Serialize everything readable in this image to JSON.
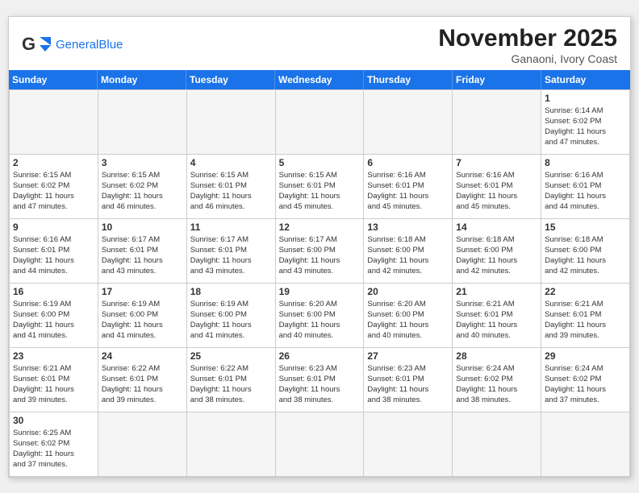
{
  "header": {
    "logo_general": "General",
    "logo_blue": "Blue",
    "month_title": "November 2025",
    "location": "Ganaoni, Ivory Coast"
  },
  "day_headers": [
    "Sunday",
    "Monday",
    "Tuesday",
    "Wednesday",
    "Thursday",
    "Friday",
    "Saturday"
  ],
  "cells": [
    {
      "day": "",
      "empty": true
    },
    {
      "day": "",
      "empty": true
    },
    {
      "day": "",
      "empty": true
    },
    {
      "day": "",
      "empty": true
    },
    {
      "day": "",
      "empty": true
    },
    {
      "day": "",
      "empty": true
    },
    {
      "day": "1",
      "info": "Sunrise: 6:14 AM\nSunset: 6:02 PM\nDaylight: 11 hours\nand 47 minutes."
    },
    {
      "day": "2",
      "info": "Sunrise: 6:15 AM\nSunset: 6:02 PM\nDaylight: 11 hours\nand 47 minutes."
    },
    {
      "day": "3",
      "info": "Sunrise: 6:15 AM\nSunset: 6:02 PM\nDaylight: 11 hours\nand 46 minutes."
    },
    {
      "day": "4",
      "info": "Sunrise: 6:15 AM\nSunset: 6:01 PM\nDaylight: 11 hours\nand 46 minutes."
    },
    {
      "day": "5",
      "info": "Sunrise: 6:15 AM\nSunset: 6:01 PM\nDaylight: 11 hours\nand 45 minutes."
    },
    {
      "day": "6",
      "info": "Sunrise: 6:16 AM\nSunset: 6:01 PM\nDaylight: 11 hours\nand 45 minutes."
    },
    {
      "day": "7",
      "info": "Sunrise: 6:16 AM\nSunset: 6:01 PM\nDaylight: 11 hours\nand 45 minutes."
    },
    {
      "day": "8",
      "info": "Sunrise: 6:16 AM\nSunset: 6:01 PM\nDaylight: 11 hours\nand 44 minutes."
    },
    {
      "day": "9",
      "info": "Sunrise: 6:16 AM\nSunset: 6:01 PM\nDaylight: 11 hours\nand 44 minutes."
    },
    {
      "day": "10",
      "info": "Sunrise: 6:17 AM\nSunset: 6:01 PM\nDaylight: 11 hours\nand 43 minutes."
    },
    {
      "day": "11",
      "info": "Sunrise: 6:17 AM\nSunset: 6:01 PM\nDaylight: 11 hours\nand 43 minutes."
    },
    {
      "day": "12",
      "info": "Sunrise: 6:17 AM\nSunset: 6:00 PM\nDaylight: 11 hours\nand 43 minutes."
    },
    {
      "day": "13",
      "info": "Sunrise: 6:18 AM\nSunset: 6:00 PM\nDaylight: 11 hours\nand 42 minutes."
    },
    {
      "day": "14",
      "info": "Sunrise: 6:18 AM\nSunset: 6:00 PM\nDaylight: 11 hours\nand 42 minutes."
    },
    {
      "day": "15",
      "info": "Sunrise: 6:18 AM\nSunset: 6:00 PM\nDaylight: 11 hours\nand 42 minutes."
    },
    {
      "day": "16",
      "info": "Sunrise: 6:19 AM\nSunset: 6:00 PM\nDaylight: 11 hours\nand 41 minutes."
    },
    {
      "day": "17",
      "info": "Sunrise: 6:19 AM\nSunset: 6:00 PM\nDaylight: 11 hours\nand 41 minutes."
    },
    {
      "day": "18",
      "info": "Sunrise: 6:19 AM\nSunset: 6:00 PM\nDaylight: 11 hours\nand 41 minutes."
    },
    {
      "day": "19",
      "info": "Sunrise: 6:20 AM\nSunset: 6:00 PM\nDaylight: 11 hours\nand 40 minutes."
    },
    {
      "day": "20",
      "info": "Sunrise: 6:20 AM\nSunset: 6:00 PM\nDaylight: 11 hours\nand 40 minutes."
    },
    {
      "day": "21",
      "info": "Sunrise: 6:21 AM\nSunset: 6:01 PM\nDaylight: 11 hours\nand 40 minutes."
    },
    {
      "day": "22",
      "info": "Sunrise: 6:21 AM\nSunset: 6:01 PM\nDaylight: 11 hours\nand 39 minutes."
    },
    {
      "day": "23",
      "info": "Sunrise: 6:21 AM\nSunset: 6:01 PM\nDaylight: 11 hours\nand 39 minutes."
    },
    {
      "day": "24",
      "info": "Sunrise: 6:22 AM\nSunset: 6:01 PM\nDaylight: 11 hours\nand 39 minutes."
    },
    {
      "day": "25",
      "info": "Sunrise: 6:22 AM\nSunset: 6:01 PM\nDaylight: 11 hours\nand 38 minutes."
    },
    {
      "day": "26",
      "info": "Sunrise: 6:23 AM\nSunset: 6:01 PM\nDaylight: 11 hours\nand 38 minutes."
    },
    {
      "day": "27",
      "info": "Sunrise: 6:23 AM\nSunset: 6:01 PM\nDaylight: 11 hours\nand 38 minutes."
    },
    {
      "day": "28",
      "info": "Sunrise: 6:24 AM\nSunset: 6:02 PM\nDaylight: 11 hours\nand 38 minutes."
    },
    {
      "day": "29",
      "info": "Sunrise: 6:24 AM\nSunset: 6:02 PM\nDaylight: 11 hours\nand 37 minutes."
    },
    {
      "day": "30",
      "info": "Sunrise: 6:25 AM\nSunset: 6:02 PM\nDaylight: 11 hours\nand 37 minutes."
    },
    {
      "day": "",
      "empty": true
    },
    {
      "day": "",
      "empty": true
    },
    {
      "day": "",
      "empty": true
    },
    {
      "day": "",
      "empty": true
    },
    {
      "day": "",
      "empty": true
    },
    {
      "day": "",
      "empty": true
    }
  ]
}
